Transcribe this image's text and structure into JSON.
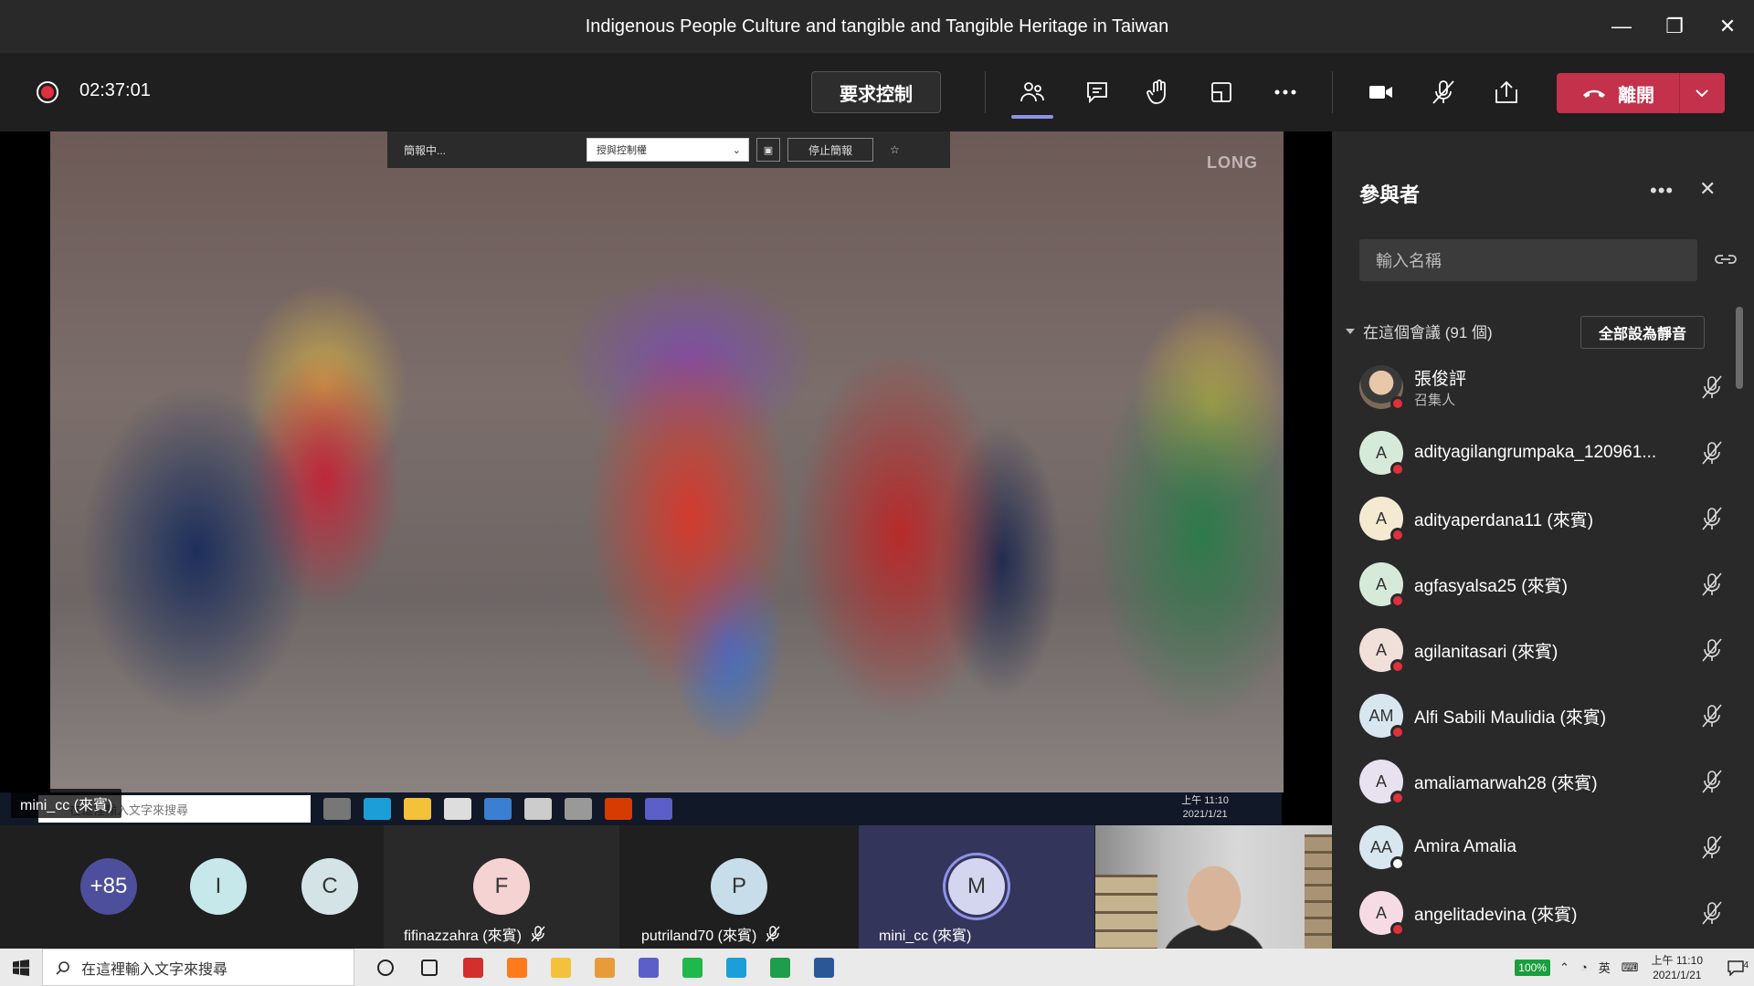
{
  "window": {
    "title": "Indigenous People Culture and tangible and Tangible Heritage in Taiwan",
    "minimize": "—",
    "restore": "❐",
    "close": "✕"
  },
  "toolbar": {
    "timer": "02:37:01",
    "request_control": "要求控制",
    "leave": "離開",
    "icons": [
      "participants-icon",
      "chat-icon",
      "raise-hand-icon",
      "rooms-icon",
      "more-icon",
      "camera-icon",
      "mic-off-icon",
      "share-tray-icon"
    ],
    "colors": {
      "leave": "#c4314b",
      "active_underline": "#8f92e8",
      "record": "#e0303b"
    }
  },
  "stage": {
    "share_bar": {
      "status": "簡報中...",
      "control_dropdown": "授與控制權",
      "stop": "停止簡報"
    },
    "watermark": "LONG",
    "shared_taskbar": {
      "search_placeholder": "在這裡輸入文字來搜尋",
      "time": "上午 11:10",
      "date": "2021/1/21"
    },
    "presenter_label": "mini_cc (來賓)"
  },
  "gallery": {
    "overflow": {
      "label": "+85",
      "color": "#4d4f9c"
    },
    "avatars": [
      {
        "initial": "I",
        "color": "#c7e8eb"
      },
      {
        "initial": "C",
        "color": "#d4e4e6"
      }
    ],
    "tiles": [
      {
        "initial": "F",
        "color": "#f6d3d3",
        "name": "fifinazzahra (來賓)",
        "muted": true
      },
      {
        "initial": "P",
        "color": "#c7dde9",
        "name": "putriland70 (來賓)",
        "muted": true
      },
      {
        "initial": "M",
        "color": "#d4d5ee",
        "name": "mini_cc (來賓)",
        "muted": false,
        "speaking": true
      }
    ]
  },
  "panel": {
    "title": "參與者",
    "more": "•••",
    "close": "✕",
    "search_placeholder": "輸入名稱",
    "section_label": "在這個會議 (91 個)",
    "mute_all": "全部設為靜音",
    "participants": [
      {
        "initial": "",
        "name": "張俊評",
        "role": "召集人",
        "color": "#c9a07a",
        "photo": true
      },
      {
        "initial": "A",
        "name": "adityagilangrumpaka_120961...",
        "color": "#d6ead9"
      },
      {
        "initial": "A",
        "name": "adityaperdana11 (來賓)",
        "color": "#f4ead1"
      },
      {
        "initial": "A",
        "name": "agfasyalsa25 (來賓)",
        "color": "#d6ead9"
      },
      {
        "initial": "A",
        "name": "agilanitasari (來賓)",
        "color": "#f1dfd9"
      },
      {
        "initial": "AM",
        "name": "Alfi Sabili Maulidia (來賓)",
        "color": "#d7e6ef"
      },
      {
        "initial": "A",
        "name": "amaliamarwah28 (來賓)",
        "color": "#e7e1f0"
      },
      {
        "initial": "AA",
        "name": "Amira Amalia",
        "color": "#d7e6ef",
        "status": "away"
      },
      {
        "initial": "A",
        "name": "angelitadevina (來賓)",
        "color": "#f6dbe4"
      }
    ]
  },
  "taskbar": {
    "search_placeholder": "在這裡輸入文字來搜尋",
    "battery": "100%",
    "ime": "英",
    "time": "上午 11:10",
    "date": "2021/1/21",
    "notifications": "4",
    "apps": [
      {
        "name": "task-view-icon",
        "color": "#222222"
      },
      {
        "name": "security-icon",
        "color": "#222222"
      },
      {
        "name": "acrobat-icon",
        "color": "#d32f2f"
      },
      {
        "name": "firefox-icon",
        "color": "#ff7a1a"
      },
      {
        "name": "file-explorer-icon",
        "color": "#f3c13a"
      },
      {
        "name": "media-player-icon",
        "color": "#e89b3b"
      },
      {
        "name": "teams-icon",
        "color": "#5b5fc7"
      },
      {
        "name": "line-icon",
        "color": "#1fb84b"
      },
      {
        "name": "edge-icon",
        "color": "#1c9fd8"
      },
      {
        "name": "sheets-icon",
        "color": "#1e9e4c"
      },
      {
        "name": "word-icon",
        "color": "#2b5797"
      }
    ]
  }
}
